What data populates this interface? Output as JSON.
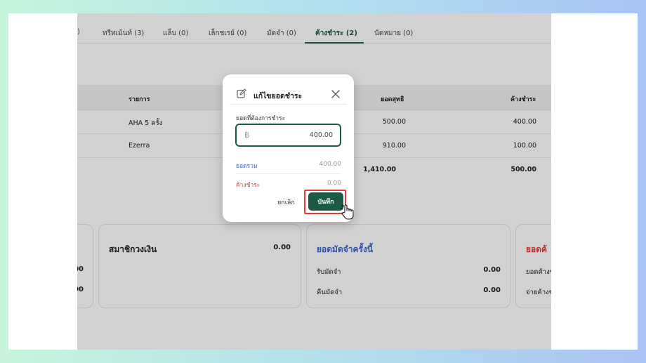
{
  "tabs": [
    {
      "label": ")"
    },
    {
      "label": "ทรีทเม้นท์ (3)"
    },
    {
      "label": "แล็บ (0)"
    },
    {
      "label": "เล็กชเรย์ (0)"
    },
    {
      "label": "มัดจำ (0)"
    },
    {
      "label": "ค้างชำระ (2)",
      "active": true
    },
    {
      "label": "นัดหมาย (0)"
    }
  ],
  "table": {
    "headers": {
      "item": "รายการ",
      "net": "ยอดสุทธิ",
      "outstanding": "ค้างชำระ"
    },
    "rows": [
      {
        "item": "AHA 5 ครั้ง",
        "net": "500.00",
        "outstanding": "400.00"
      },
      {
        "item": "Ezerra",
        "net": "910.00",
        "outstanding": "100.00"
      }
    ],
    "total": {
      "net": "1,410.00",
      "outstanding": "500.00"
    }
  },
  "cards": {
    "left_partial": {
      "lines": [
        "00",
        "00"
      ]
    },
    "wallet": {
      "title": "สมาชิกวงเงิน",
      "value": "0.00"
    },
    "deposit": {
      "title": "ยอดมัดจำครั้งนี้",
      "title_color": "#3a63c8",
      "lines": [
        {
          "label": "รับมัดจำ",
          "value": "0.00"
        },
        {
          "label": "คืนมัดจำ",
          "value": "0.00"
        }
      ]
    },
    "right_partial": {
      "title": "ยอดค้",
      "title_color": "#e23b3b",
      "lines": [
        "ยอดค้างช",
        "จ่ายค้างช"
      ]
    }
  },
  "modal": {
    "title": "แก้ไขยอดชำระ",
    "field_label": "ยอดที่ต้องการชำระ",
    "currency_symbol": "฿",
    "amount": "400.00",
    "total_label": "ยอดรวม",
    "total_value": "400.00",
    "total_color": "#3a63c8",
    "outstanding_label": "ค้างชำระ",
    "outstanding_value": "0.00",
    "outstanding_color": "#e23b3b",
    "cancel_label": "ยกเลิก",
    "save_label": "บันทึก",
    "icons": {
      "edit": "edit-icon",
      "close": "close-icon"
    }
  },
  "colors": {
    "primary": "#1c5a45",
    "highlight": "#e23b3b"
  }
}
